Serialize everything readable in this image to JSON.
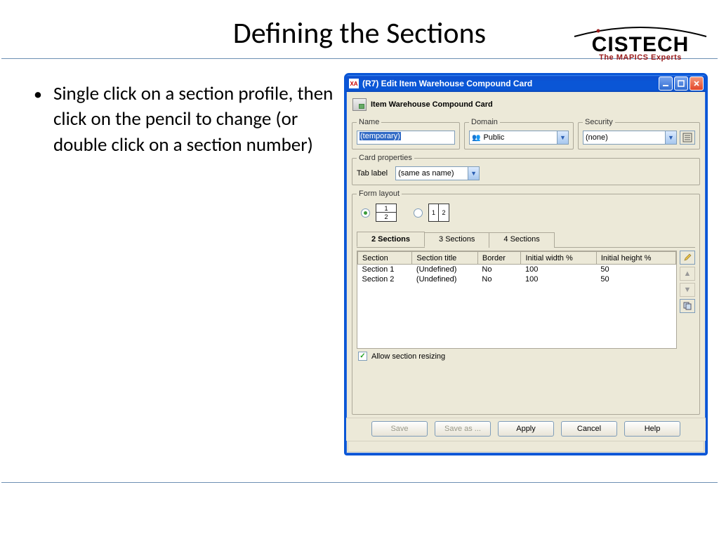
{
  "slide": {
    "title": "Defining the Sections",
    "bullet": "Single click on a section profile, then click on the pencil to change (or double click on a section number)"
  },
  "logo": {
    "name": "CISTECH",
    "tagline": "The MAPICS Experts"
  },
  "window": {
    "title": "(R7) Edit Item Warehouse Compound Card",
    "header": "Item Warehouse Compound Card",
    "name_label": "Name",
    "name_value": "(temporary)",
    "domain_label": "Domain",
    "domain_value": "Public",
    "security_label": "Security",
    "security_value": "(none)",
    "cardprops_label": "Card properties",
    "tablabel_label": "Tab label",
    "tablabel_value": "(same as name)",
    "formlayout_label": "Form layout",
    "tabs": [
      "2 Sections",
      "3 Sections",
      "4 Sections"
    ],
    "grid": {
      "columns": [
        "Section",
        "Section title",
        "Border",
        "Initial width %",
        "Initial height %"
      ],
      "rows": [
        {
          "section": "Section 1",
          "title": "(Undefined)",
          "border": "No",
          "w": "100",
          "h": "50"
        },
        {
          "section": "Section 2",
          "title": "(Undefined)",
          "border": "No",
          "w": "100",
          "h": "50"
        }
      ]
    },
    "allow_resize_label": "Allow section resizing",
    "allow_resize_checked": true,
    "buttons": {
      "save": "Save",
      "saveas": "Save as ...",
      "apply": "Apply",
      "cancel": "Cancel",
      "help": "Help"
    }
  }
}
